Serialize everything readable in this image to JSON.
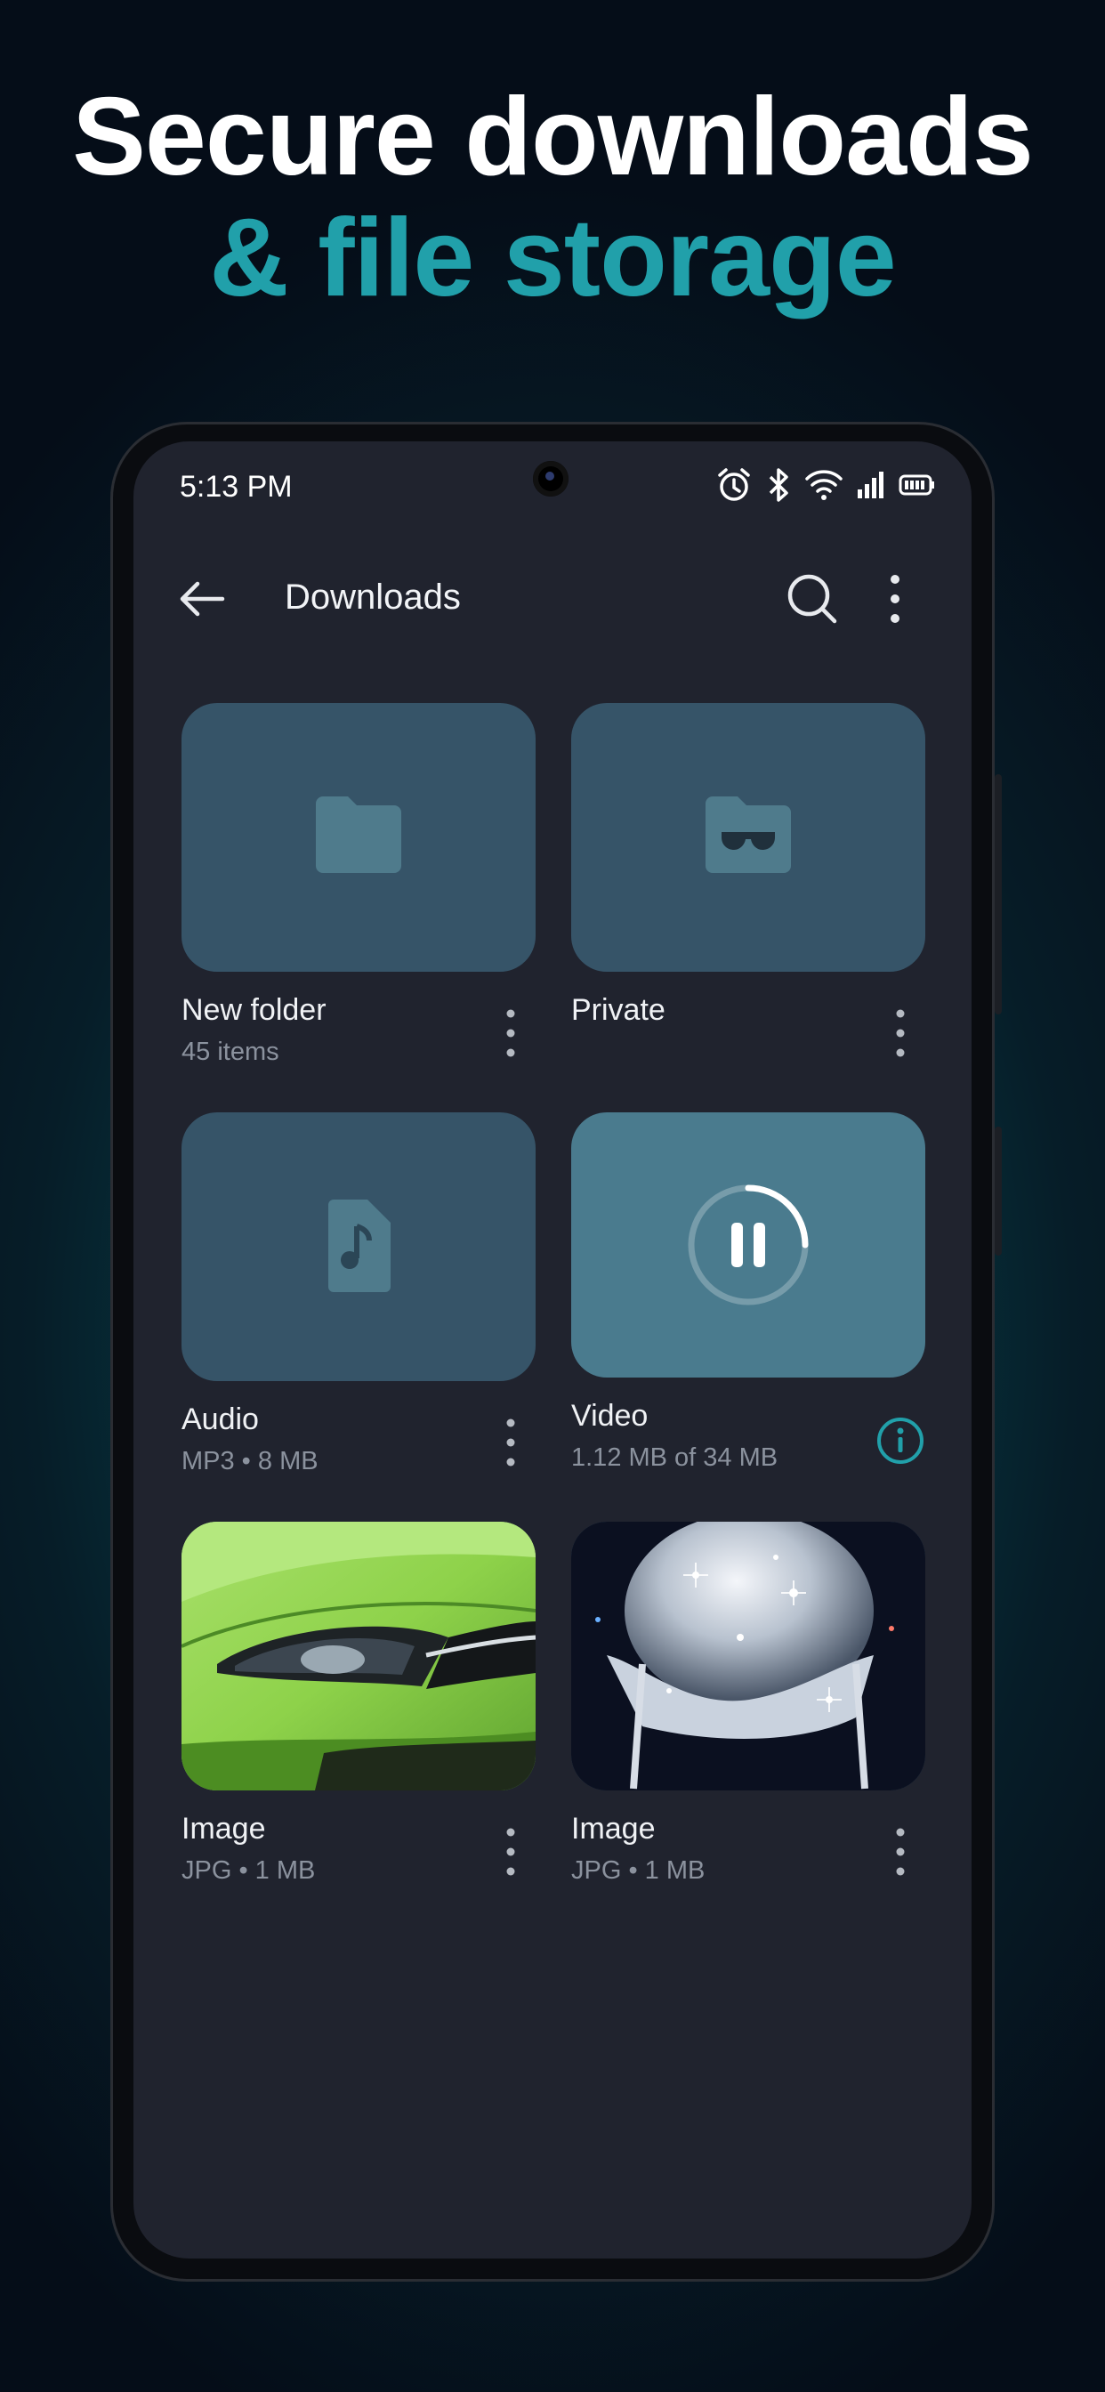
{
  "headline": {
    "line1": "Secure downloads",
    "line2": "& file storage"
  },
  "status_bar": {
    "time": "5:13 PM",
    "icons": [
      "alarm-icon",
      "bluetooth-icon",
      "wifi-icon",
      "signal-icon",
      "battery-icon"
    ]
  },
  "top_bar": {
    "title": "Downloads",
    "back_icon": "arrow-left-icon",
    "search_icon": "search-icon",
    "more_icon": "more-vert-icon"
  },
  "items": [
    {
      "name": "New folder",
      "meta": "45 items",
      "icon": "folder-icon"
    },
    {
      "name": "Private",
      "meta": "",
      "icon": "private-folder-icon"
    },
    {
      "name": "Audio",
      "meta": "MP3 • 8 MB",
      "icon": "audio-file-icon"
    },
    {
      "name": "Video",
      "meta": "1.12 MB of 34 MB",
      "icon": "pause-icon",
      "progress": 0.033
    },
    {
      "name": "Image",
      "meta": "JPG • 1 MB",
      "icon": "image-thumbnail"
    },
    {
      "name": "Image",
      "meta": "JPG • 1 MB",
      "icon": "image-thumbnail"
    }
  ],
  "colors": {
    "accent": "#21a0aa",
    "tile": "#365468",
    "tile_active": "#4a7b8e",
    "screen_bg": "#20232e"
  }
}
